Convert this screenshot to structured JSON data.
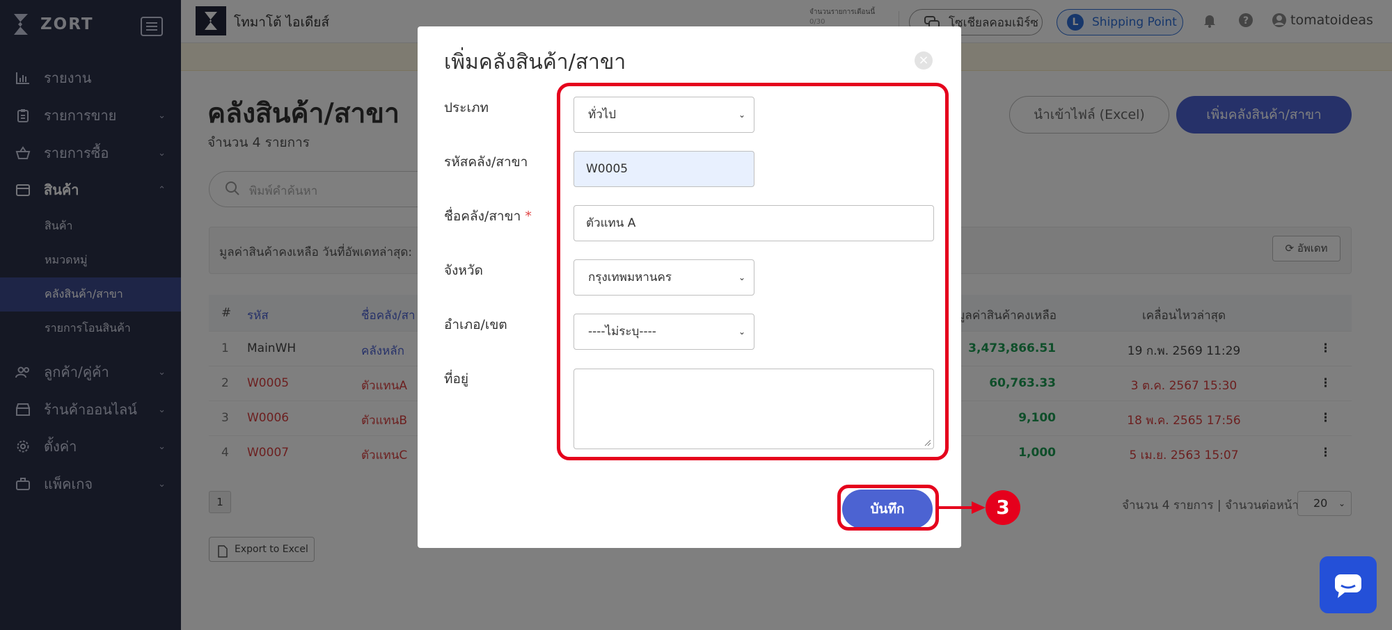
{
  "app": {
    "brand": "ZORT",
    "company": "โทมาโต้ ไอเดียส์",
    "user": "tomatoideas"
  },
  "sidebar": {
    "items": [
      {
        "label": "รายงาน"
      },
      {
        "label": "รายการขาย"
      },
      {
        "label": "รายการซื้อ"
      },
      {
        "label": "สินค้า"
      },
      {
        "label": "ลูกค้า/คู่ค้า"
      },
      {
        "label": "ร้านค้าออนไลน์"
      },
      {
        "label": "ตั้งค่า"
      },
      {
        "label": "แพ็คเกจ"
      }
    ],
    "sub_items": [
      {
        "label": "สินค้า"
      },
      {
        "label": "หมวดหมู่"
      },
      {
        "label": "คลังสินค้า/สาขา"
      },
      {
        "label": "รายการโอนสินค้า"
      }
    ]
  },
  "topbar": {
    "quota_label": "จำนวนรายการเดือนนี้",
    "quota_value": "0/30",
    "social_label": "โซเชียลคอมเมิร์ซ",
    "shipping_label": "Shipping Point",
    "shipping_badge": "L"
  },
  "page": {
    "title": "คลังสินค้า/สาขา",
    "count": "จำนวน 4 รายการ",
    "import_button": "นำเข้าไฟล์ (Excel)",
    "add_button": "เพิ่มคลังสินค้า/สาขา",
    "search_placeholder": "พิมพ์คำค้นหา",
    "info_text": "มูลค่าสินค้าคงเหลือ วันที่อัพเดทล่าสุด:",
    "update_button": "อัพเดท",
    "page_number": "1",
    "page_info": "จำนวน 4 รายการ | จำนวนต่อหน้า",
    "page_size": "20",
    "export_button": "Export to Excel"
  },
  "table": {
    "headers": {
      "num": "#",
      "code": "รหัส",
      "name": "ชื่อคลัง/สา",
      "value": "มูลค่าสินค้าคงเหลือ",
      "last_move": "เคลื่อนไหวล่าสุด"
    },
    "rows": [
      {
        "num": "1",
        "code": "MainWH",
        "name": "คลังหลัก",
        "value": "3,473,866.51",
        "date": "19 ก.พ. 2569 11:29"
      },
      {
        "num": "2",
        "code": "W0005",
        "name": "ตัวแทนA",
        "value": "60,763.33",
        "date": "3 ต.ค. 2567 15:30"
      },
      {
        "num": "3",
        "code": "W0006",
        "name": "ตัวแทนB",
        "value": "9,100",
        "date": "18 พ.ค. 2565 17:56"
      },
      {
        "num": "4",
        "code": "W0007",
        "name": "ตัวแทนC",
        "value": "1,000",
        "date": "5 เม.ย. 2563 15:07"
      }
    ]
  },
  "modal": {
    "title": "เพิ่มคลังสินค้า/สาขา",
    "close_symbol": "×",
    "type_label": "ประเภท",
    "type_value": "ทั่วไป",
    "code_label": "รหัสคลัง/สาขา",
    "code_value": "W0005",
    "name_label": "ชื่อคลัง/สาขา",
    "name_required": "*",
    "name_value": "ตัวแทน A",
    "province_label": "จังหวัด",
    "province_value": "กรุงเทพมหานคร",
    "district_label": "อำเภอ/เขต",
    "district_value": "----ไม่ระบุ----",
    "address_label": "ที่อยู่",
    "address_value": "",
    "save_button": "บันทึก"
  },
  "annotation": {
    "step": "3",
    "color": "#e5001c"
  },
  "colors": {
    "sidebar": "#2b3049",
    "accent": "#4c63d2",
    "positive": "#1f9d55",
    "alert": "#d94040"
  }
}
